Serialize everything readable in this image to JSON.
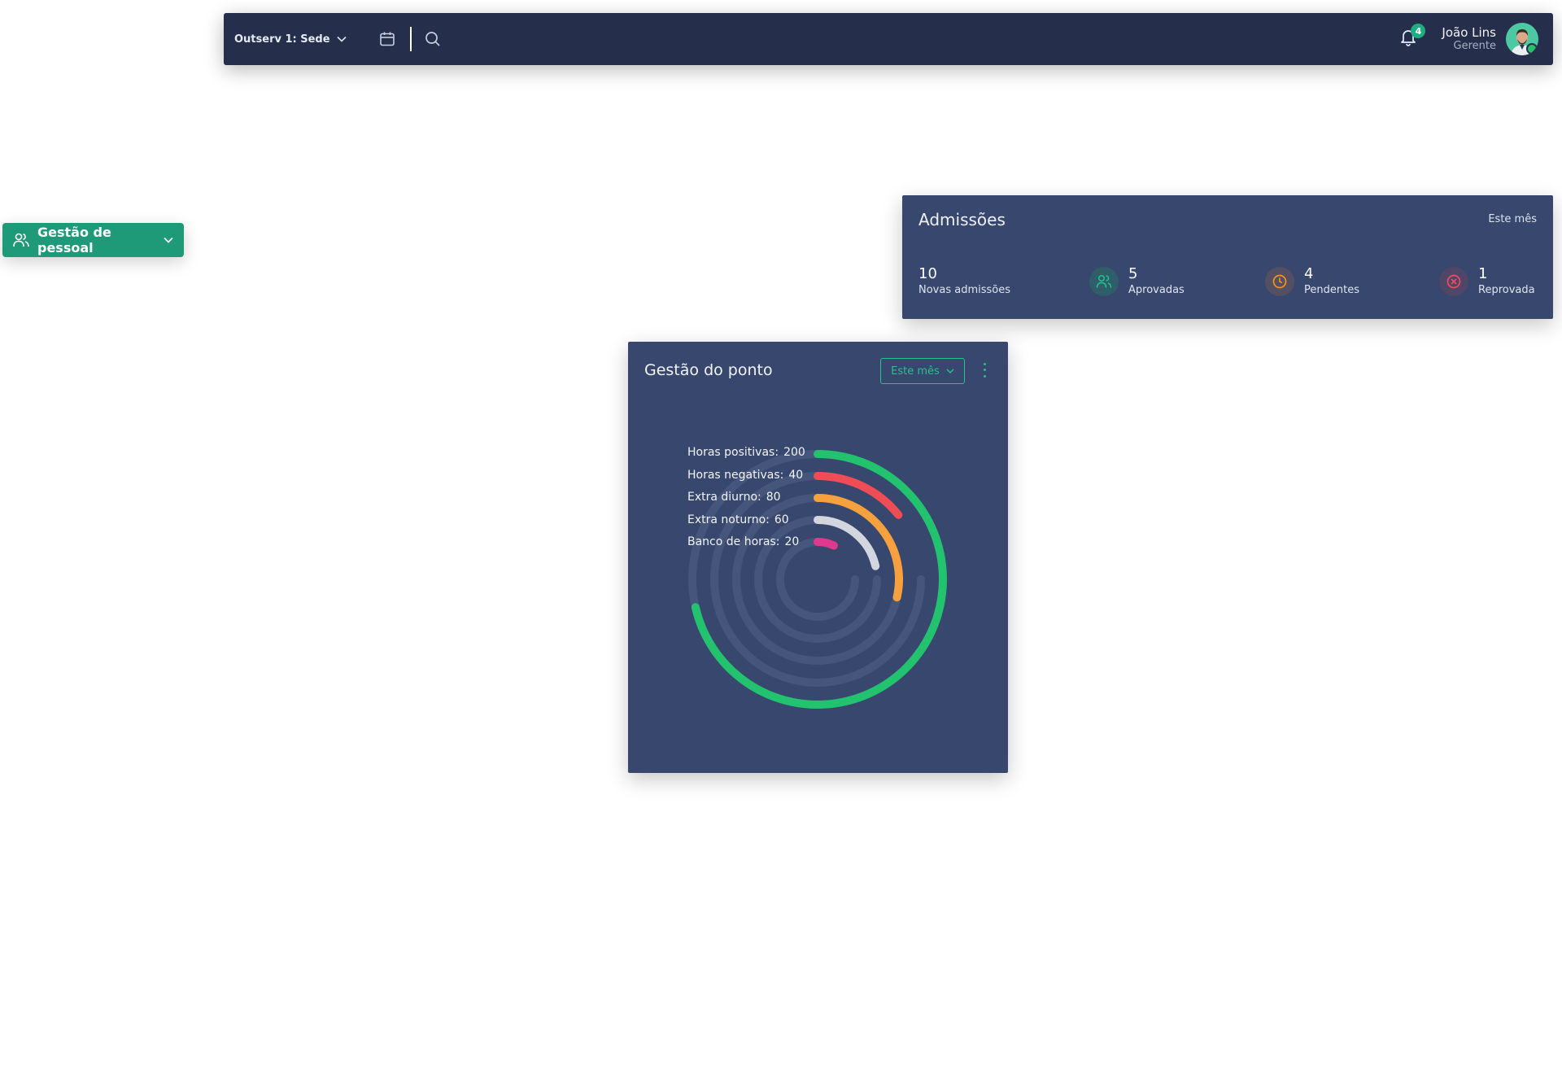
{
  "topbar": {
    "branch_label": "Outserv 1: Sede",
    "notifications_count": "4",
    "user_name": "João Lins",
    "user_role": "Gerente"
  },
  "menu": {
    "label": "Gestão de pessoal"
  },
  "admissions": {
    "title": "Admissões",
    "period": "Este mês",
    "stats": [
      {
        "value": "10",
        "label": "Novas admissões"
      },
      {
        "value": "5",
        "label": "Aprovadas",
        "icon": "users-icon",
        "color": "#22c38e"
      },
      {
        "value": "4",
        "label": "Pendentes",
        "icon": "clock-icon",
        "color": "#f7941d"
      },
      {
        "value": "1",
        "label": "Reprovada",
        "icon": "x-circle-icon",
        "color": "#ef4d5b"
      }
    ]
  },
  "ponto": {
    "title": "Gestão do ponto",
    "period_select": "Este mês"
  },
  "chart_data": {
    "type": "radial-bar",
    "max": 280,
    "series": [
      {
        "name": "Horas positivas:",
        "value": "200",
        "color": "#22c26e"
      },
      {
        "name": "Horas negativas:",
        "value": "40",
        "color": "#ef4d55"
      },
      {
        "name": "Extra diurno:",
        "value": "80",
        "color": "#f7a13e"
      },
      {
        "name": "Extra noturno:",
        "value": "60",
        "color": "#d3d6de"
      },
      {
        "name": "Banco de horas:",
        "value": "20",
        "color": "#e0388f"
      }
    ],
    "track_color": "#46557c"
  }
}
